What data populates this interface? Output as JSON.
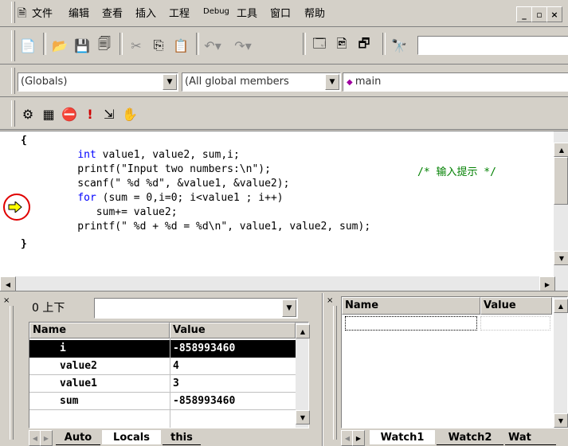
{
  "menu": [
    "文件",
    "编辑",
    "查看",
    "插入",
    "工程",
    "Debug",
    "工具",
    "窗口",
    "帮助"
  ],
  "window_controls": [
    "_",
    "ł",
    "×"
  ],
  "toolbar": {
    "scope_combo": "(Globals)",
    "members_combo": "(All global members",
    "function_combo": "main"
  },
  "code": {
    "lines": [
      "{",
      "    int value1, value2, sum,i;",
      "    printf(\"Input two numbers:\\n\");",
      "    scanf(\" %d %d\", &value1, &value2);",
      "    for (sum = 0,i=0; i<value1 ; i++)",
      "       sum+= value2;",
      "    printf(\" %d + %d = %d\\n\", value1, value2, sum);",
      "}"
    ],
    "comment": "/* 输入提示 */"
  },
  "variables": {
    "context": "0 上下",
    "headers": [
      "Name",
      "Value"
    ],
    "rows": [
      {
        "name": "i",
        "value": "-858993460"
      },
      {
        "name": "value2",
        "value": "4"
      },
      {
        "name": "value1",
        "value": "3"
      },
      {
        "name": "sum",
        "value": "-858993460"
      }
    ],
    "tabs": [
      "Auto",
      "Locals",
      "this"
    ]
  },
  "watch": {
    "headers": [
      "Name",
      "Value"
    ],
    "tabs": [
      "Watch1",
      "Watch2",
      "Wat"
    ]
  }
}
